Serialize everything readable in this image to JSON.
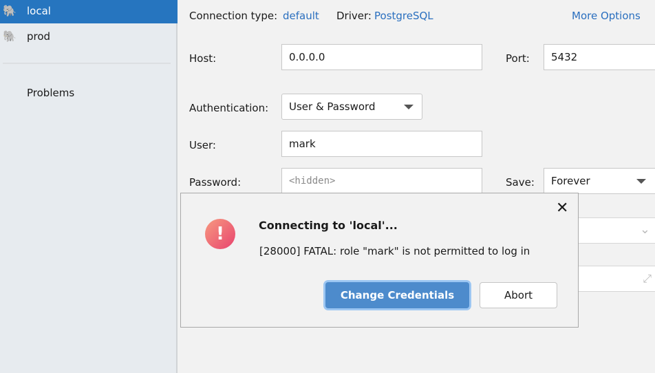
{
  "sidebar": {
    "items": [
      {
        "label": "local",
        "icon": "postgresql-elephant-icon",
        "selected": true
      },
      {
        "label": "prod",
        "icon": "postgresql-elephant-icon",
        "selected": false
      }
    ],
    "problems": "Problems"
  },
  "form": {
    "connection_type_label": "Connection type:",
    "connection_type": "default",
    "driver_label": "Driver:",
    "driver": "PostgreSQL",
    "more_options": "More Options",
    "host_label": "Host:",
    "host": "0.0.0.0",
    "port_label": "Port:",
    "port": "5432",
    "auth_label": "Authentication:",
    "auth": "User & Password",
    "user_label": "User:",
    "user": "mark",
    "password_label": "Password:",
    "password_placeholder": "<hidden>",
    "save_label": "Save:",
    "save": "Forever"
  },
  "dialog": {
    "title": "Connecting to 'local'...",
    "message": "[28000] FATAL: role \"mark\" is not permitted to log in",
    "primary": "Change Credentials",
    "secondary": "Abort"
  },
  "colors": {
    "accent": "#2675bf",
    "link": "#2a6fbf",
    "error": "#e8436e"
  }
}
